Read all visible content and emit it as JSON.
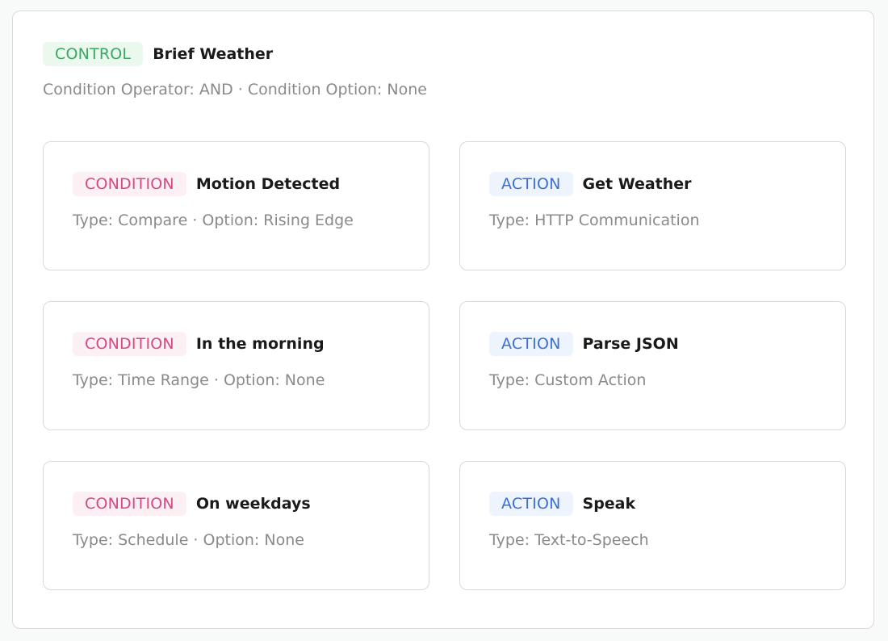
{
  "control": {
    "badge": "CONTROL",
    "title": "Brief Weather",
    "subtitle": "Condition Operator: AND · Condition Option: None"
  },
  "cards": [
    {
      "badge": "CONDITION",
      "title": "Motion Detected",
      "subtitle": "Type: Compare · Option: Rising Edge"
    },
    {
      "badge": "ACTION",
      "title": "Get Weather",
      "subtitle": "Type: HTTP Communication"
    },
    {
      "badge": "CONDITION",
      "title": "In the morning",
      "subtitle": "Type: Time Range · Option: None"
    },
    {
      "badge": "ACTION",
      "title": "Parse JSON",
      "subtitle": "Type: Custom Action"
    },
    {
      "badge": "CONDITION",
      "title": "On weekdays",
      "subtitle": "Type: Schedule · Option: None"
    },
    {
      "badge": "ACTION",
      "title": "Speak",
      "subtitle": "Type: Text-to-Speech"
    }
  ],
  "colors": {
    "control": "#3aa863",
    "condition": "#d44a84",
    "action": "#3b6fd4"
  }
}
